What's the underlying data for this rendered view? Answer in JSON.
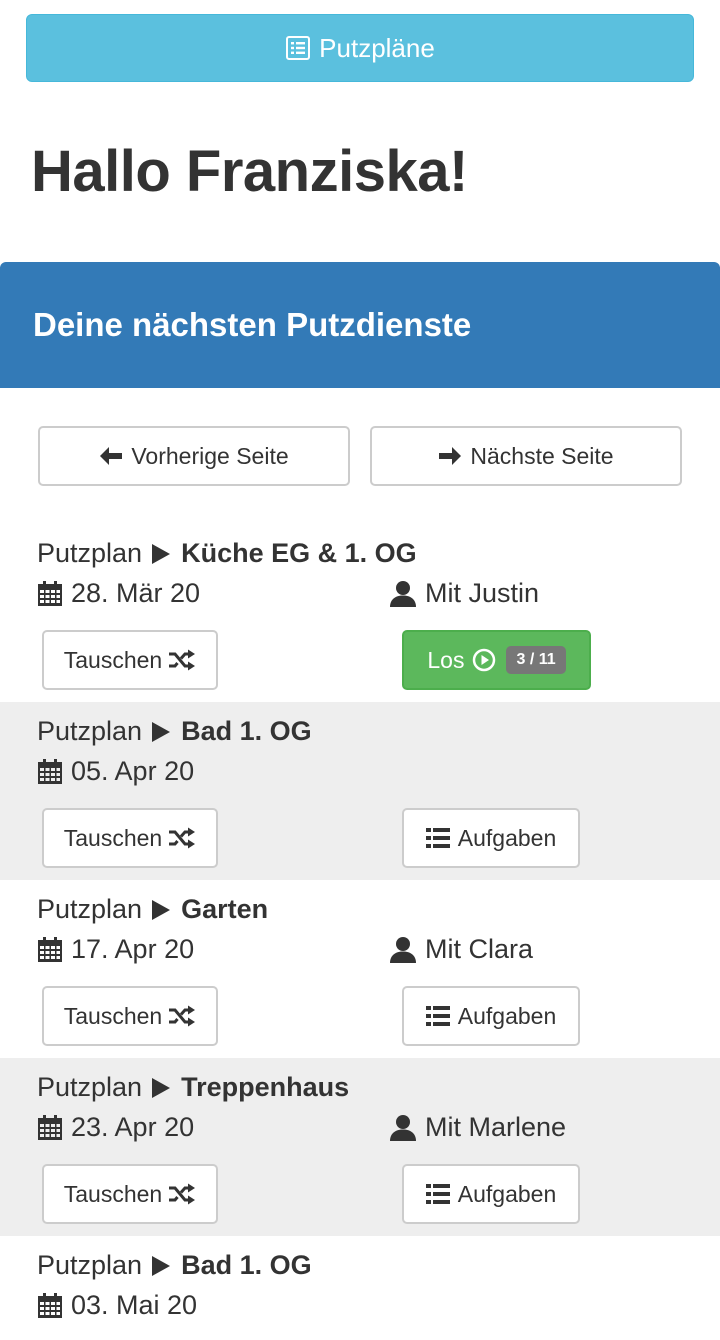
{
  "header": {
    "plans_button_label": "Putzpläne",
    "greeting": "Hallo Franziska!"
  },
  "panel": {
    "title": "Deine nächsten Putzdienste"
  },
  "pager": {
    "prev_label": "Vorherige Seite",
    "next_label": "Nächste Seite"
  },
  "labels": {
    "plan_prefix": "Putzplan",
    "swap": "Tauschen",
    "tasks": "Aufgaben",
    "go": "Los"
  },
  "duties": [
    {
      "plan": "Küche EG & 1. OG",
      "date": "28. Mär 20",
      "with": "Mit Justin",
      "action": "go",
      "progress": "3 / 11"
    },
    {
      "plan": "Bad 1. OG",
      "date": "05. Apr 20",
      "with": "",
      "action": "tasks"
    },
    {
      "plan": "Garten",
      "date": "17. Apr 20",
      "with": "Mit Clara",
      "action": "tasks"
    },
    {
      "plan": "Treppenhaus",
      "date": "23. Apr 20",
      "with": "Mit Marlene",
      "action": "tasks"
    },
    {
      "plan": "Bad 1. OG",
      "date": "03. Mai 20",
      "with": ""
    }
  ],
  "colors": {
    "info": "#5bc0de",
    "primary": "#337ab7",
    "success": "#5cb85c",
    "badge": "#777777",
    "alt_row": "#eeeeee"
  },
  "icons": {
    "plans": "list-alt-icon",
    "prev": "arrow-left-icon",
    "next": "arrow-right-icon",
    "plan_arrow": "play-icon",
    "date": "calendar-icon",
    "with": "user-icon",
    "swap": "random-icon",
    "tasks": "list-icon",
    "go": "play-circle-icon"
  }
}
